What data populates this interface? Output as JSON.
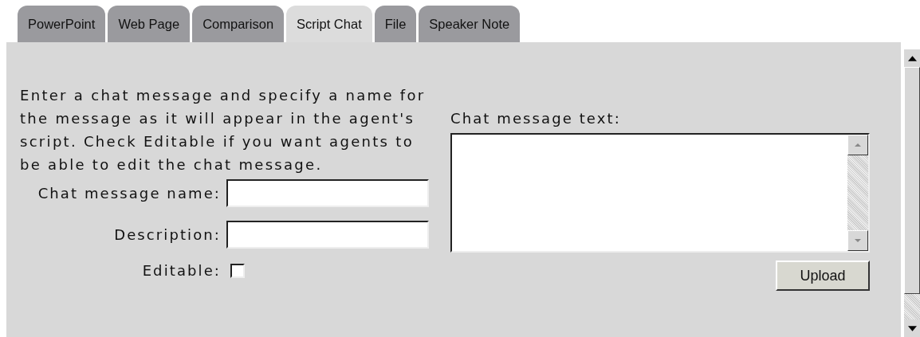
{
  "tabs": [
    {
      "label": "PowerPoint",
      "selected": false
    },
    {
      "label": "Web Page",
      "selected": false
    },
    {
      "label": "Comparison",
      "selected": false
    },
    {
      "label": "Script Chat",
      "selected": true
    },
    {
      "label": "File",
      "selected": false
    },
    {
      "label": "Speaker Note",
      "selected": false
    }
  ],
  "instructions": "Enter a chat message and specify a name for the message as it will appear in the agent's script. Check Editable if you want agents to be able to edit the chat message.",
  "fields": [
    {
      "label": "Chat message name:",
      "kind": "text"
    },
    {
      "label": "Description:",
      "kind": "text"
    },
    {
      "label": "Editable:",
      "kind": "checkbox",
      "checked": false
    }
  ],
  "message_text": {
    "label": "Chat message text:"
  },
  "upload_button": "Upload"
}
